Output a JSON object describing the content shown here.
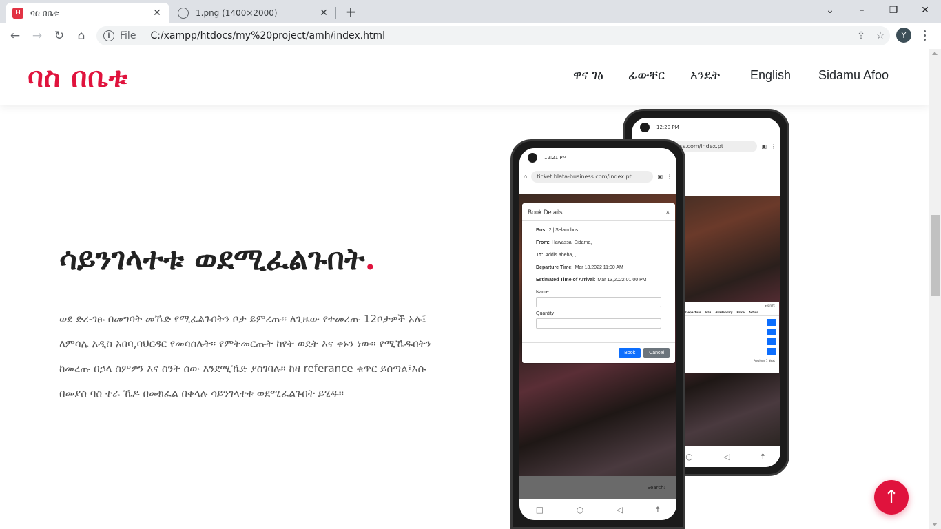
{
  "browser": {
    "tabs": [
      {
        "title": "ባስ በቤቱ",
        "favicon": "H",
        "active": true
      },
      {
        "title": "1.png (1400×2000)",
        "favicon": "globe-icon",
        "active": false
      }
    ],
    "new_tab": "+",
    "window_controls": {
      "minimize": "–",
      "maximize": "❐",
      "close": "✕",
      "tab_search": "⌄"
    },
    "address": {
      "scheme": "File",
      "url": "C:/xampp/htdocs/my%20project/amh/index.html"
    },
    "profile_initial": "Y"
  },
  "site": {
    "logo": "ባስ በቤቱ",
    "nav": [
      "ዋና ገፅ",
      "ፊውቸር",
      "እንዴት",
      "English",
      "Sidamu Afoo"
    ],
    "hero": {
      "title": "ሳይንገላተቱ ወደሚፈልጉበት",
      "title_dot": ".",
      "body": "ወደ ድረ-ገፁ በመግባት መኼድ የሚፈልጉበትን ቦታ ይምረጡ። ለጊዜው የተመረጡ 12ቦታዎች አሉ፤ ለምሳሌ አዲስ አበባ,ባህርዳር የመሳሰሉት። የምትመርጡት ከየት ወዴት እና ቀኑን ነው። የሚኼዱበትን ከመረጡ በኃላ ስምዎን እና ስንት ሰው እንደሚኼድ ያስገባሉ። ከዛ referance ቁጥር ይሰጣል፤እሱ በመያስ ባስ ተራ ኼዶ በመክፈል በቀላሉ ሳይንገላተቱ ወደሚፈልጉበት ይሂዱ።"
    },
    "back_to_top": "↑"
  },
  "phone_front": {
    "time": "12:21 PM",
    "url": "ticket.blata-business.com/index.pt",
    "modal": {
      "title": "Book Details",
      "close": "×",
      "bus_label": "Bus:",
      "bus_value": "2 | Selam bus",
      "from_label": "From:",
      "from_value": "Hawassa, Sidama,",
      "to_label": "To:",
      "to_value": "Addis abeba, ,",
      "departure_label": "Departure Time:",
      "departure_value": "Mar 13,2022 11:00 AM",
      "arrival_label": "Estimated Time of Arrival:",
      "arrival_value": "Mar 13,2022 01:00 PM",
      "name_label": "Name",
      "quantity_label": "Quantity",
      "book": "Book",
      "cancel": "Cancel"
    },
    "search_label": "Search:"
  },
  "phone_back": {
    "time": "12:20 PM",
    "url": "blata-business.com/index.pt",
    "table_headers": [
      "Departure",
      "ETA",
      "Availability",
      "Price",
      "Action"
    ],
    "search_label": "Search:",
    "pager": [
      "Previous",
      "1",
      "Next"
    ]
  },
  "colors": {
    "brand": "#e0133d",
    "primary_button": "#0d6efd",
    "secondary_button": "#6c757d"
  }
}
